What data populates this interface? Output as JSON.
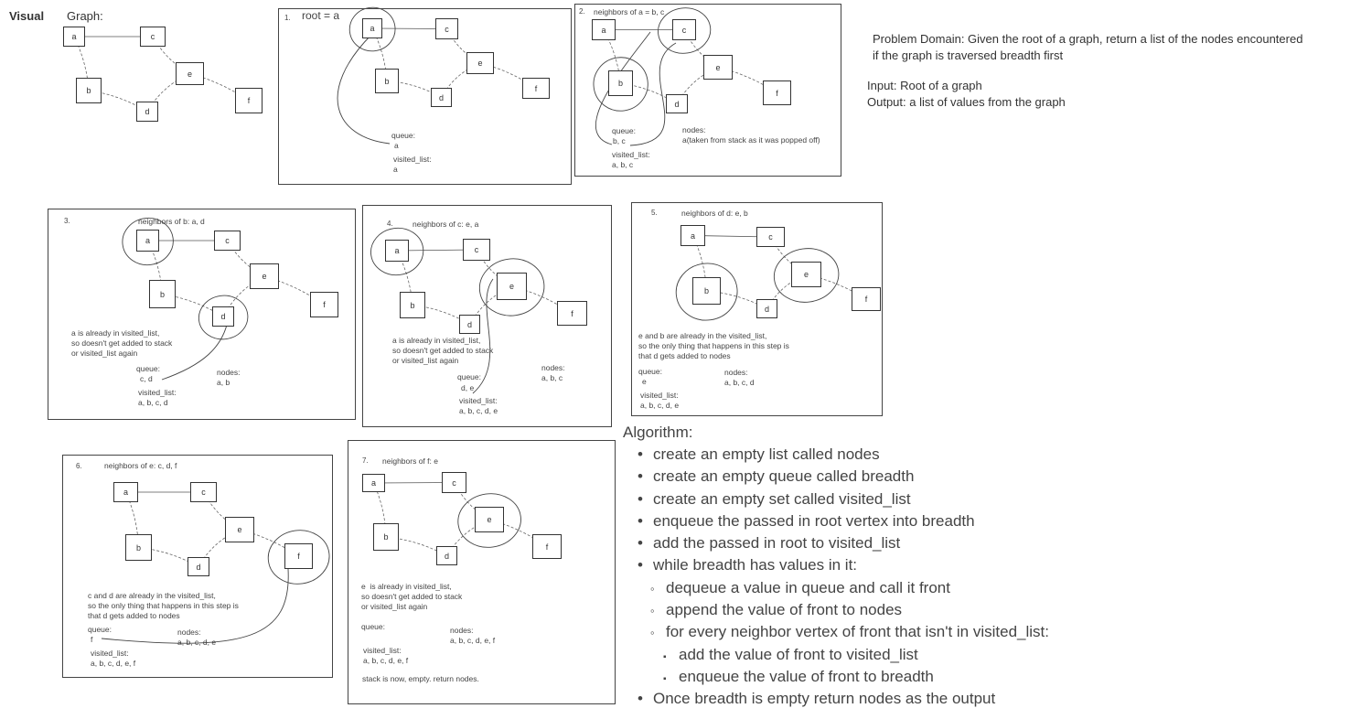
{
  "header": {
    "side_label": "Visual",
    "graph_label": "Graph:"
  },
  "graph": {
    "nodes": [
      "a",
      "b",
      "c",
      "d",
      "e",
      "f"
    ],
    "solid_edges": [
      [
        "a",
        "c"
      ]
    ],
    "dashed_edges": [
      [
        "a",
        "b"
      ],
      [
        "b",
        "d"
      ],
      [
        "c",
        "e"
      ],
      [
        "d",
        "e"
      ],
      [
        "e",
        "f"
      ]
    ]
  },
  "steps": [
    {
      "number": "1.",
      "title": "root = a",
      "queue_label": "queue:",
      "queue": "a",
      "visited_label": "visited_list:",
      "visited": "a",
      "circled": [
        "a"
      ]
    },
    {
      "number": "2.",
      "title": "neighbors of a = b, c",
      "queue_label": "queue:",
      "queue": "b, c",
      "visited_label": "visited_list:",
      "visited": "a, b, c",
      "nodes_label": "nodes:",
      "nodes": "a(taken from stack as it was popped off)",
      "circled": [
        "c",
        "b"
      ]
    },
    {
      "number": "3.",
      "title": "neighbors of b: a, d",
      "note": "a is already in visited_list,\nso doesn't get added to stack\nor visited_list again",
      "queue_label": "queue:",
      "queue": "c, d",
      "visited_label": "visited_list:",
      "visited": "a, b, c, d",
      "nodes_label": "nodes:",
      "nodes": "a, b",
      "circled": [
        "a",
        "d"
      ]
    },
    {
      "number": "4.",
      "title": "neighbors of c: e, a",
      "note": "a is already in visited_list,\nso doesn't get added to stack\nor visited_list again",
      "queue_label": "queue:",
      "queue": "d, e",
      "visited_label": "visited_list:",
      "visited": "a, b, c, d, e",
      "nodes_label": "nodes:",
      "nodes": "a, b, c",
      "circled": [
        "a",
        "e"
      ]
    },
    {
      "number": "5.",
      "title": "neighbors of d: e, b",
      "note": "e and b are already in the visited_list,\nso the only thing that happens in this step is\nthat d gets added to nodes",
      "queue_label": "queue:",
      "queue": "e",
      "visited_label": "visited_list:",
      "visited": "a, b, c, d, e",
      "nodes_label": "nodes:",
      "nodes": "a, b, c, d",
      "circled": [
        "b",
        "e"
      ]
    },
    {
      "number": "6.",
      "title": "neighbors of e: c, d, f",
      "note": "c and d are already in the visited_list,\nso the only thing that happens in this step is\nthat d gets added to nodes",
      "queue_label": "queue:",
      "queue": "f",
      "visited_label": "visited_list:",
      "visited": "a, b, c, d, e, f",
      "nodes_label": "nodes:",
      "nodes": "a, b, c, d, e",
      "circled": [
        "f"
      ]
    },
    {
      "number": "7.",
      "title": "neighbors of f: e",
      "note": "e  is already in visited_list,\nso doesn't get added to stack\nor visited_list again",
      "queue_label": "queue:",
      "queue": "",
      "visited_label": "visited_list:",
      "visited": "a, b, c, d, e, f",
      "nodes_label": "nodes:",
      "nodes": "a, b, c, d, e, f",
      "footer": "stack is now, empty. return nodes.",
      "circled": [
        "e"
      ]
    }
  ],
  "problem": {
    "domain_line1": "Problem Domain: Given the root of a graph, return a list of the nodes encountered",
    "domain_line2": "if the graph is traversed breadth first",
    "input": "Input: Root of a graph",
    "output": "Output: a list of values from the graph"
  },
  "algorithm": {
    "title": "Algorithm:",
    "items": [
      {
        "level": 1,
        "text": "create an empty list called nodes"
      },
      {
        "level": 1,
        "text": "create an empty queue called breadth"
      },
      {
        "level": 1,
        "text": "create an empty set called visited_list"
      },
      {
        "level": 1,
        "text": "enqueue the passed in root vertex into breadth"
      },
      {
        "level": 1,
        "text": "add the passed in root to visited_list"
      },
      {
        "level": 1,
        "text": "while breadth has values in it:"
      },
      {
        "level": 2,
        "text": "dequeue a value in queue and call it front"
      },
      {
        "level": 2,
        "text": "append the value of front to nodes"
      },
      {
        "level": 2,
        "text": "for every neighbor vertex of front that isn't in visited_list:"
      },
      {
        "level": 3,
        "text": "add the value of front to visited_list"
      },
      {
        "level": 3,
        "text": "enqueue the value of front to breadth"
      },
      {
        "level": 1,
        "text": "Once breadth is empty return nodes as the output"
      }
    ]
  },
  "colors": {
    "ink": "#333333",
    "border": "#444444"
  }
}
